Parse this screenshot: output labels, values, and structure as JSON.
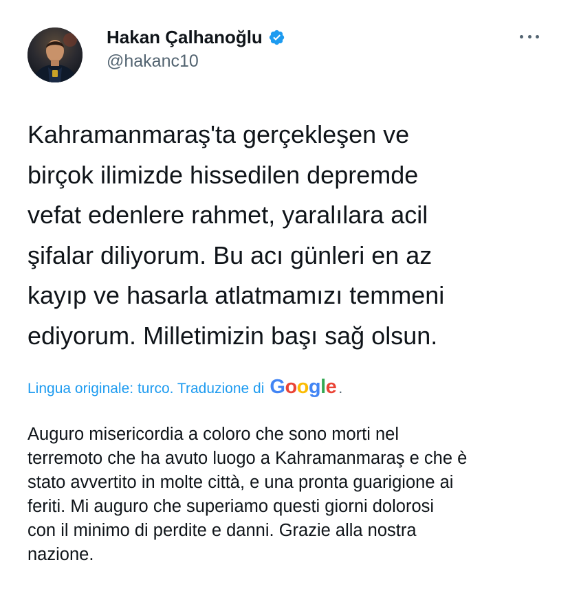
{
  "author": {
    "display_name": "Hakan Çalhanoğlu",
    "handle": "@hakanc10",
    "verified": true
  },
  "tweet": {
    "text": "Kahramanmaraş'ta gerçekleşen ve\nbirçok ilimizde hissedilen depremde\nvefat edenlere rahmet, yaralılara acil\nşifalar diliyorum. Bu acı günleri en az\nkayıp ve hasarla atlatmamızı temmeni\nediyorum. Milletimizin başı sağ olsun."
  },
  "translation": {
    "label": "Lingua originale: turco. Traduzione di",
    "provider_letters": [
      "G",
      "o",
      "o",
      "g",
      "l",
      "e"
    ],
    "period": ".",
    "text": "Auguro misericordia a coloro che sono morti nel\nterremoto che ha avuto luogo a Kahramanmaraş e che è\nstato avvertito in molte città, e una pronta guarigione ai\nferiti. Mi auguro che superiamo questi giorni dolorosi\ncon il minimo di perdite e danni. Grazie alla nostra\nnazione."
  },
  "colors": {
    "text_primary": "#0f1419",
    "text_secondary": "#536471",
    "link": "#1d9bf0",
    "verified_badge": "#1d9bf0"
  },
  "icons": {
    "avatar": "avatar",
    "verified": "verified-badge-icon",
    "more": "more-options-icon"
  }
}
